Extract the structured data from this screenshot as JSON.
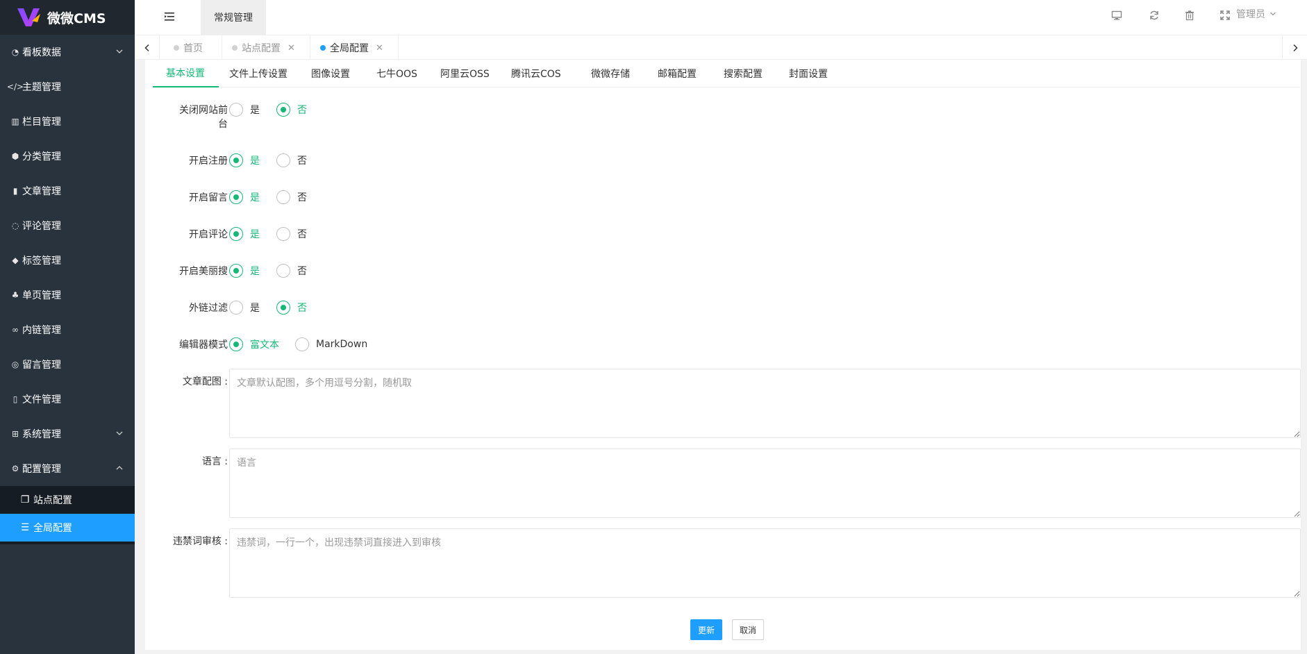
{
  "app": {
    "name": "微微CMS"
  },
  "sidebar": {
    "items": [
      {
        "label": "看板数据",
        "icon": "dashboard-icon",
        "expandable": true,
        "expanded": false
      },
      {
        "label": "主题管理",
        "icon": "code-icon"
      },
      {
        "label": "栏目管理",
        "icon": "columns-icon"
      },
      {
        "label": "分类管理",
        "icon": "cube-icon"
      },
      {
        "label": "文章管理",
        "icon": "book-icon"
      },
      {
        "label": "评论管理",
        "icon": "comment-icon"
      },
      {
        "label": "标签管理",
        "icon": "tags-icon"
      },
      {
        "label": "单页管理",
        "icon": "page-icon"
      },
      {
        "label": "内链管理",
        "icon": "link-icon"
      },
      {
        "label": "留言管理",
        "icon": "message-icon"
      },
      {
        "label": "文件管理",
        "icon": "file-icon"
      },
      {
        "label": "系统管理",
        "icon": "windows-icon",
        "expandable": true,
        "expanded": false
      },
      {
        "label": "配置管理",
        "icon": "gears-icon",
        "expandable": true,
        "expanded": true
      }
    ],
    "children": [
      {
        "label": "站点配置",
        "icon": "copy-icon",
        "active": false
      },
      {
        "label": "全局配置",
        "icon": "list-icon",
        "active": true
      }
    ]
  },
  "header": {
    "main_tab": "常规管理",
    "admin_label": "管理员",
    "icons": [
      "monitor-icon",
      "refresh-icon",
      "trash-icon",
      "fullscreen-icon"
    ]
  },
  "page_tabs": [
    {
      "label": "首页",
      "closable": false,
      "active": false
    },
    {
      "label": "站点配置",
      "closable": true,
      "active": false
    },
    {
      "label": "全局配置",
      "closable": true,
      "active": true
    }
  ],
  "sub_tabs": [
    "基本设置",
    "文件上传设置",
    "图像设置",
    "七牛OOS",
    "阿里云OSS",
    "腾讯云COS",
    "微微存储",
    "邮箱配置",
    "搜索配置",
    "封面设置"
  ],
  "form": {
    "close_site": {
      "label_line1": "关闭网站前",
      "label_line2": "台",
      "yes": "是",
      "no": "否",
      "value": "否"
    },
    "register": {
      "label": "开启注册",
      "yes": "是",
      "no": "否",
      "value": "是"
    },
    "guestbook": {
      "label": "开启留言",
      "yes": "是",
      "no": "否",
      "value": "是"
    },
    "comment": {
      "label": "开启评论",
      "yes": "是",
      "no": "否",
      "value": "是"
    },
    "meilisearch": {
      "label": "开启美丽搜",
      "yes": "是",
      "no": "否",
      "value": "是"
    },
    "link_filter": {
      "label": "外链过滤",
      "yes": "是",
      "no": "否",
      "value": "否"
    },
    "editor_mode": {
      "label": "编辑器模式",
      "opt1": "富文本",
      "opt2": "MarkDown",
      "value": "富文本"
    },
    "cover_images": {
      "label": "文章配图 :",
      "placeholder": "文章默认配图，多个用逗号分割，随机取"
    },
    "language": {
      "label": "语言 :",
      "placeholder": "语言"
    },
    "banned_words": {
      "label": "违禁词审核 :",
      "placeholder": "违禁词，一行一个，出现违禁词直接进入到审核"
    }
  },
  "buttons": {
    "submit": "更新",
    "cancel": "取消"
  },
  "colors": {
    "sidebar_bg": "#28333e",
    "active_blue": "#1e9fff",
    "accent_green": "#16b777"
  }
}
